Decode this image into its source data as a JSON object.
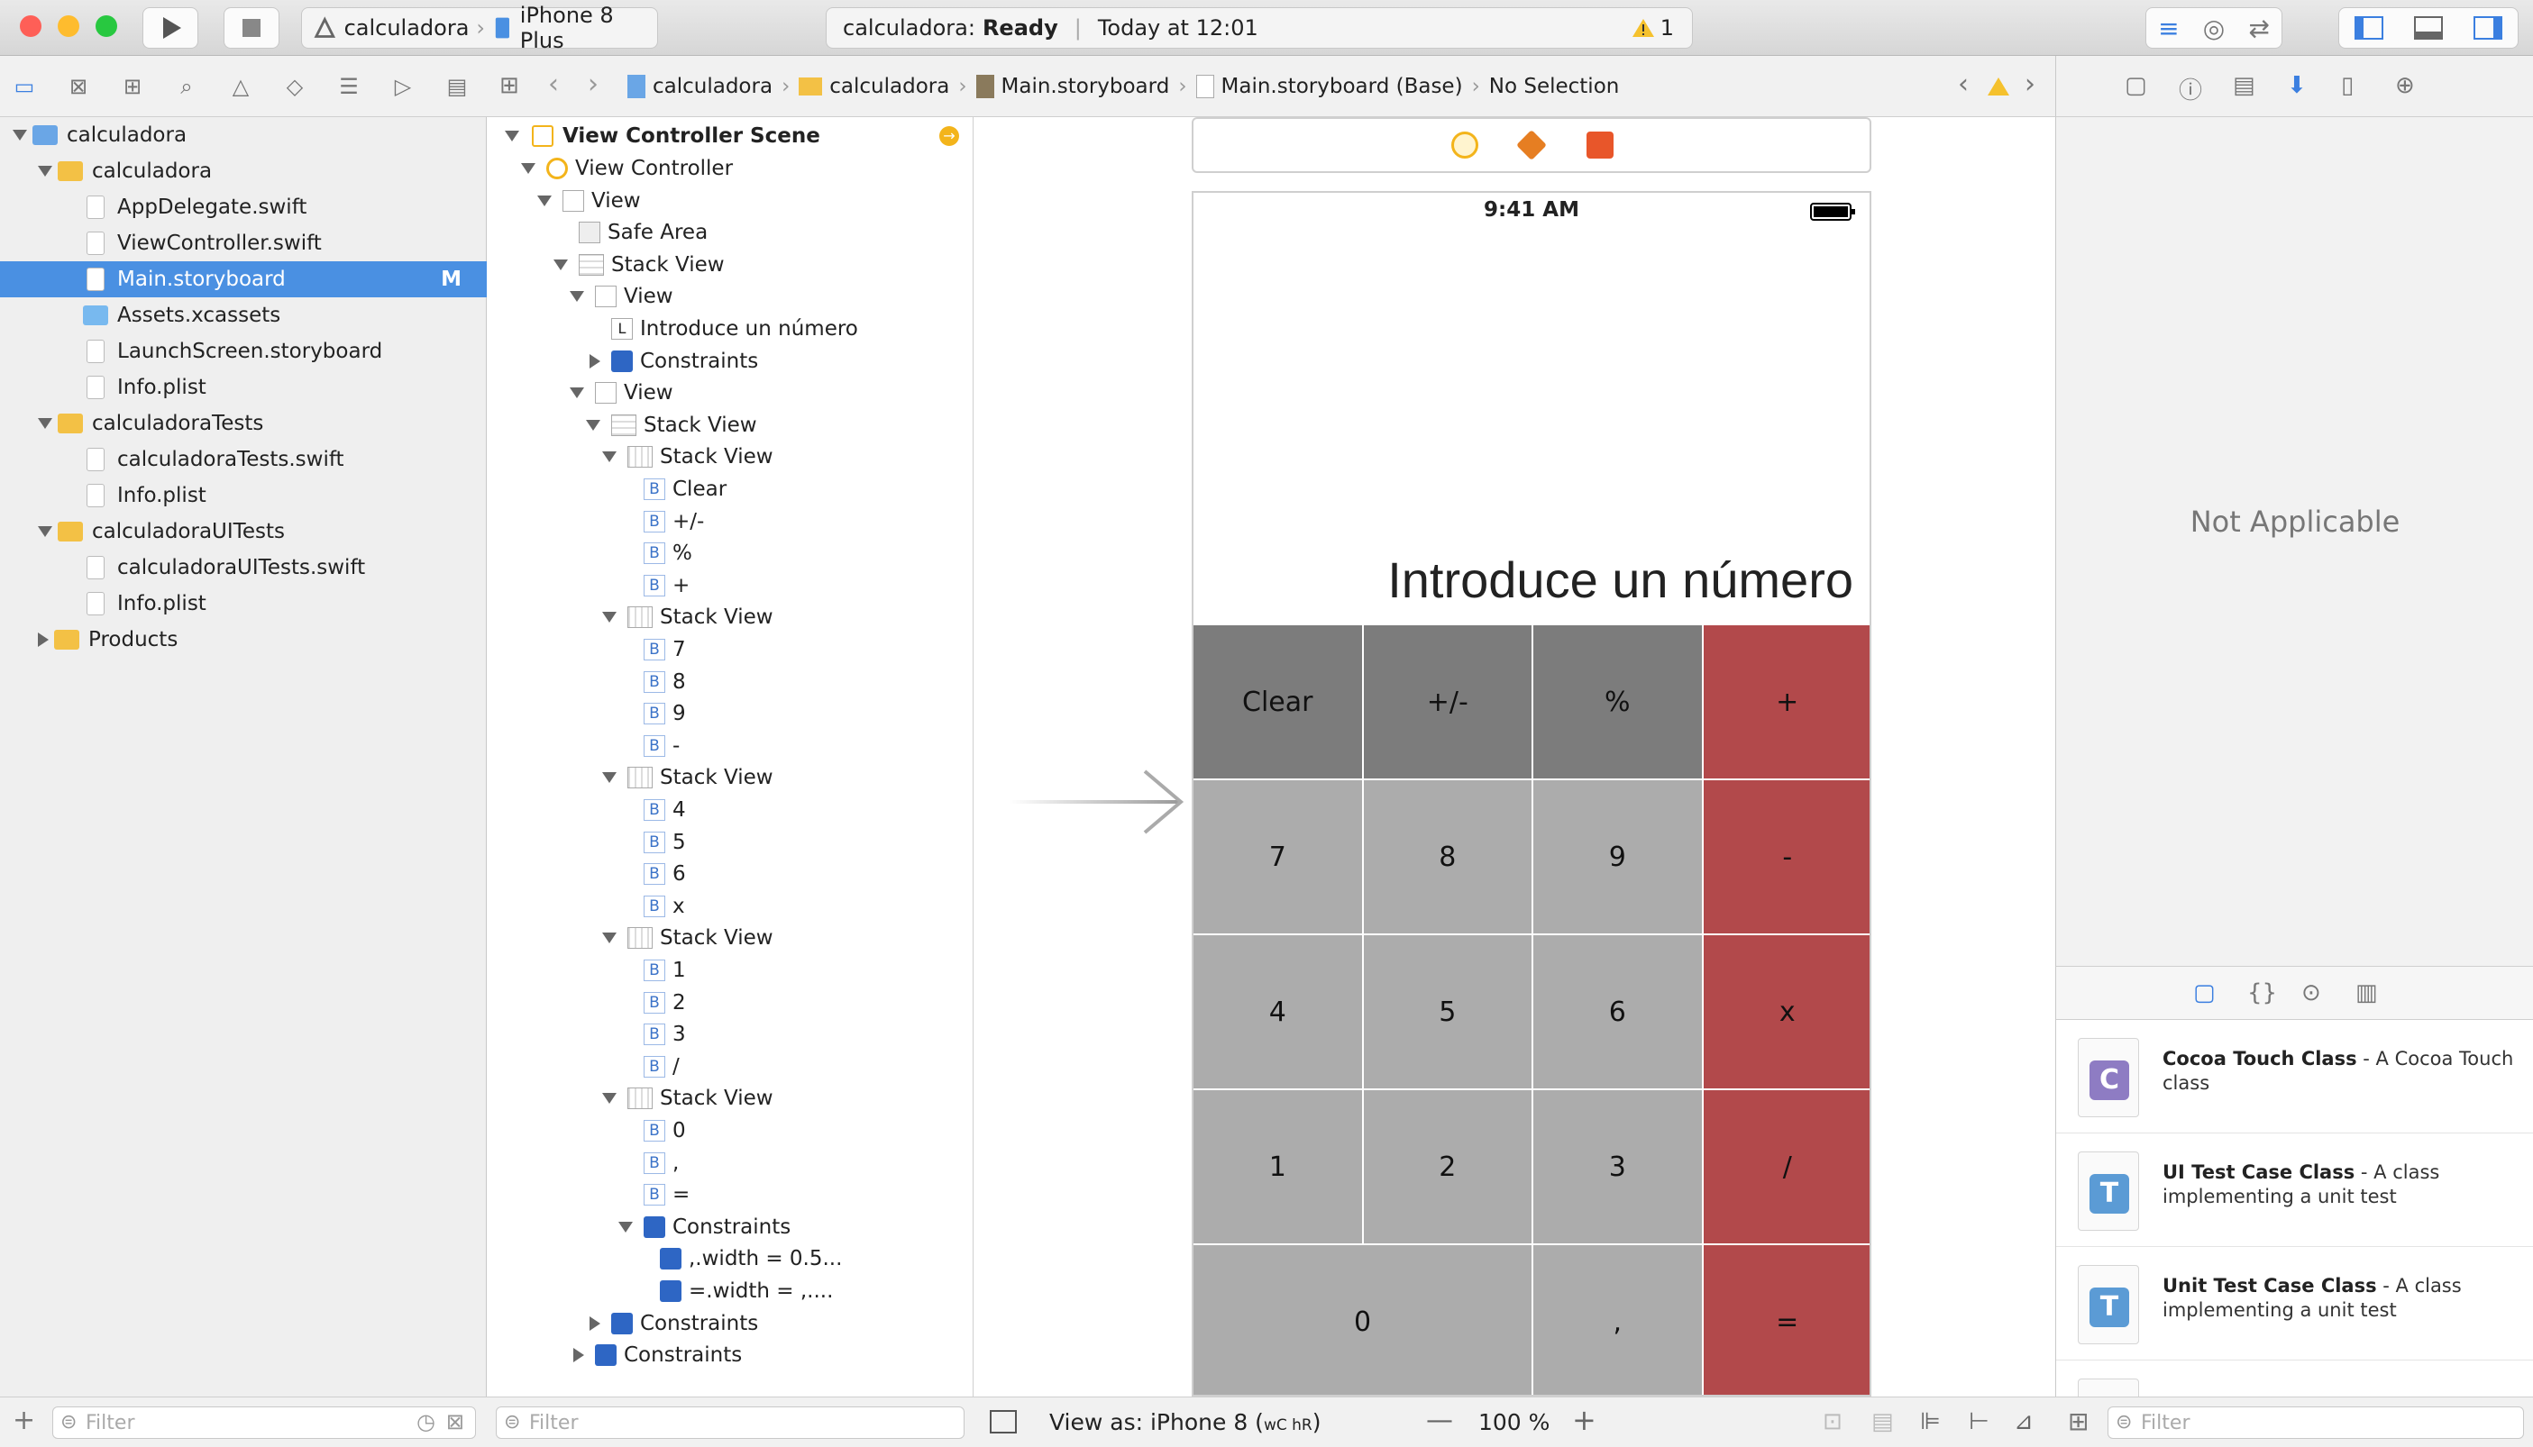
{
  "window": {
    "scheme_project": "calculadora",
    "scheme_device": "iPhone 8 Plus",
    "status_project": "calculadora:",
    "status_state": "Ready",
    "status_time": "Today at 12:01",
    "warning_count": "1"
  },
  "navigator": {
    "items": [
      {
        "label": "calculadora",
        "level": 0,
        "kind": "project",
        "disclosure": "down"
      },
      {
        "label": "calculadora",
        "level": 1,
        "kind": "folder",
        "disclosure": "down"
      },
      {
        "label": "AppDelegate.swift",
        "level": 2,
        "kind": "file"
      },
      {
        "label": "ViewController.swift",
        "level": 2,
        "kind": "file"
      },
      {
        "label": "Main.storyboard",
        "level": 2,
        "kind": "file",
        "selected": true,
        "badge": "M"
      },
      {
        "label": "Assets.xcassets",
        "level": 2,
        "kind": "assets"
      },
      {
        "label": "LaunchScreen.storyboard",
        "level": 2,
        "kind": "file"
      },
      {
        "label": "Info.plist",
        "level": 2,
        "kind": "file"
      },
      {
        "label": "calculadoraTests",
        "level": 1,
        "kind": "folder",
        "disclosure": "down"
      },
      {
        "label": "calculadoraTests.swift",
        "level": 2,
        "kind": "file"
      },
      {
        "label": "Info.plist",
        "level": 2,
        "kind": "file"
      },
      {
        "label": "calculadoraUITests",
        "level": 1,
        "kind": "folder",
        "disclosure": "down"
      },
      {
        "label": "calculadoraUITests.swift",
        "level": 2,
        "kind": "file"
      },
      {
        "label": "Info.plist",
        "level": 2,
        "kind": "file"
      },
      {
        "label": "Products",
        "level": 1,
        "kind": "folder",
        "disclosure": "right"
      }
    ],
    "filter_placeholder": "Filter"
  },
  "jumpbar": {
    "crumbs": [
      "calculadora",
      "calculadora",
      "Main.storyboard",
      "Main.storyboard (Base)",
      "No Selection"
    ]
  },
  "outline": {
    "scene_title": "View Controller Scene",
    "rows": [
      {
        "label": "View Controller",
        "level": 1,
        "icon": "vc",
        "disclosure": "down"
      },
      {
        "label": "View",
        "level": 2,
        "icon": "view",
        "disclosure": "down"
      },
      {
        "label": "Safe Area",
        "level": 3,
        "icon": "safe"
      },
      {
        "label": "Stack View",
        "level": 3,
        "icon": "hstack",
        "disclosure": "down"
      },
      {
        "label": "View",
        "level": 4,
        "icon": "view",
        "disclosure": "down"
      },
      {
        "label": "Introduce un número",
        "level": 5,
        "icon": "label"
      },
      {
        "label": "Constraints",
        "level": 5,
        "icon": "constraints",
        "disclosure": "right"
      },
      {
        "label": "View",
        "level": 4,
        "icon": "view",
        "disclosure": "down"
      },
      {
        "label": "Stack View",
        "level": 5,
        "icon": "hstack",
        "disclosure": "down"
      },
      {
        "label": "Stack View",
        "level": 6,
        "icon": "vstack",
        "disclosure": "down"
      },
      {
        "label": "Clear",
        "level": 7,
        "icon": "button"
      },
      {
        "label": "+/-",
        "level": 7,
        "icon": "button"
      },
      {
        "label": "%",
        "level": 7,
        "icon": "button"
      },
      {
        "label": "+",
        "level": 7,
        "icon": "button"
      },
      {
        "label": "Stack View",
        "level": 6,
        "icon": "vstack",
        "disclosure": "down"
      },
      {
        "label": "7",
        "level": 7,
        "icon": "button"
      },
      {
        "label": "8",
        "level": 7,
        "icon": "button"
      },
      {
        "label": "9",
        "level": 7,
        "icon": "button"
      },
      {
        "label": "-",
        "level": 7,
        "icon": "button"
      },
      {
        "label": "Stack View",
        "level": 6,
        "icon": "vstack",
        "disclosure": "down"
      },
      {
        "label": "4",
        "level": 7,
        "icon": "button"
      },
      {
        "label": "5",
        "level": 7,
        "icon": "button"
      },
      {
        "label": "6",
        "level": 7,
        "icon": "button"
      },
      {
        "label": "x",
        "level": 7,
        "icon": "button"
      },
      {
        "label": "Stack View",
        "level": 6,
        "icon": "vstack",
        "disclosure": "down"
      },
      {
        "label": "1",
        "level": 7,
        "icon": "button"
      },
      {
        "label": "2",
        "level": 7,
        "icon": "button"
      },
      {
        "label": "3",
        "level": 7,
        "icon": "button"
      },
      {
        "label": "/",
        "level": 7,
        "icon": "button"
      },
      {
        "label": "Stack View",
        "level": 6,
        "icon": "vstack",
        "disclosure": "down"
      },
      {
        "label": "0",
        "level": 7,
        "icon": "button"
      },
      {
        "label": ",",
        "level": 7,
        "icon": "button"
      },
      {
        "label": "=",
        "level": 7,
        "icon": "button"
      },
      {
        "label": "Constraints",
        "level": 7,
        "icon": "constraints",
        "disclosure": "down"
      },
      {
        "label": ",.width = 0.5...",
        "level": 8,
        "icon": "constraint"
      },
      {
        "label": "=.width = ,....",
        "level": 8,
        "icon": "constraint"
      },
      {
        "label": "Constraints",
        "level": 5,
        "icon": "constraints",
        "disclosure": "right"
      },
      {
        "label": "Constraints",
        "level": 4,
        "icon": "constraints",
        "disclosure": "right"
      }
    ],
    "filter_placeholder": "Filter"
  },
  "device": {
    "time": "9:41 AM",
    "display_text": "Introduce un número",
    "keys": [
      [
        "Clear",
        "+/-",
        "%",
        "+"
      ],
      [
        "7",
        "8",
        "9",
        "-"
      ],
      [
        "4",
        "5",
        "6",
        "x"
      ],
      [
        "1",
        "2",
        "3",
        "/"
      ],
      [
        "0",
        ",",
        "="
      ]
    ],
    "colors": {
      "dark": "#7c7c7c",
      "light": "#acacac",
      "red": "#b2494b"
    }
  },
  "canvas_bar": {
    "view_as": "View as: iPhone 8 (",
    "size_class": "wC hR",
    "zoom": "100 %"
  },
  "inspector": {
    "empty_text": "Not Applicable"
  },
  "library": {
    "items": [
      {
        "title": "Cocoa Touch Class",
        "desc": " - A Cocoa Touch class",
        "glyph": "C",
        "color": "#8e7cc3"
      },
      {
        "title": "UI Test Case Class",
        "desc": " - A class implementing a unit test",
        "glyph": "T",
        "color": "#5b9bd5"
      },
      {
        "title": "Unit Test Case Class",
        "desc": " - A class implementing a unit test",
        "glyph": "T",
        "color": "#5b9bd5"
      }
    ],
    "filter_placeholder": "Filter"
  }
}
